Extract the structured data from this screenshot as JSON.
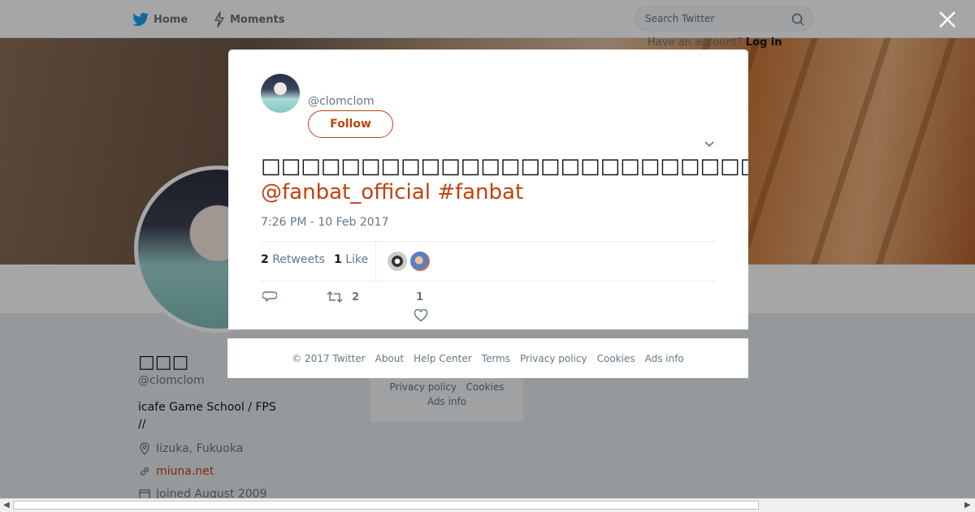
{
  "nav": {
    "home_label": "Home",
    "moments_label": "Moments",
    "search_placeholder": "Search Twitter",
    "have_account": "Have an account?",
    "login_label": "Log in"
  },
  "profile": {
    "name": "□□□",
    "handle": "@clomclom",
    "bio": "icafe Game School  / FPS //",
    "location": "Iizuka, Fukuoka",
    "url": "miuna.net",
    "joined": "Joined August 2009"
  },
  "side_footer": {
    "line1_a": "Privacy policy",
    "line1_b": "Cookies",
    "line2": "Ads info"
  },
  "tweet": {
    "handle": "@clomclom",
    "follow_label": "Follow",
    "text": "□□□□□□□□□□□□□□□□□□□□□□□□□□□□□□□□□□□□□□□□□□□□□□□□or□□□□□□□□□□□□□□□□□□□□□□□□□□",
    "mention": "@fanbat_official",
    "hashtag": "#fanbat",
    "time": "7:26 PM - 10 Feb 2017",
    "retweet_count": "2",
    "retweets_label": "Retweets",
    "like_count": "1",
    "like_label": "Like",
    "action_retweet_count": "2",
    "action_like_count": "1"
  },
  "footer": {
    "copyright": "© 2017 Twitter",
    "about": "About",
    "help": "Help Center",
    "terms": "Terms",
    "privacy": "Privacy policy",
    "cookies": "Cookies",
    "ads": "Ads info"
  },
  "colors": {
    "accent": "#c0420f",
    "twitter_blue": "#1da1f2"
  }
}
